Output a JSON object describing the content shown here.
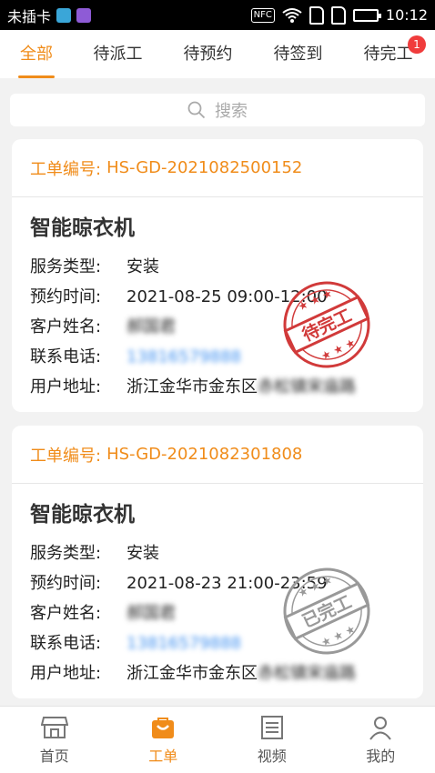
{
  "status_bar": {
    "carrier": "未插卡",
    "nfc": "NFC",
    "time": "10:12"
  },
  "tabs": [
    {
      "label": "全部",
      "active": true
    },
    {
      "label": "待派工"
    },
    {
      "label": "待预约"
    },
    {
      "label": "待签到"
    },
    {
      "label": "待完工",
      "badge": "1"
    }
  ],
  "search": {
    "placeholder": "搜索"
  },
  "orders": [
    {
      "number_label": "工单编号:",
      "number": "HS-GD-2021082500152",
      "product": "智能晾衣机",
      "fields": [
        {
          "label": "服务类型:",
          "value": "安装"
        },
        {
          "label": "预约时间:",
          "value": "2021-08-25 09:00-12:00"
        },
        {
          "label": "客户姓名:",
          "value": "郝国君"
        },
        {
          "label": "联系电话:",
          "value": "13816579888"
        },
        {
          "label": "用户地址:",
          "value": "浙江金华市金东区",
          "blurred": "赤松镇宋庙路"
        }
      ],
      "stamp": "待完工",
      "stamp_color": "#d13a3a"
    },
    {
      "number_label": "工单编号:",
      "number": "HS-GD-2021082301808",
      "product": "智能晾衣机",
      "fields": [
        {
          "label": "服务类型:",
          "value": "安装"
        },
        {
          "label": "预约时间:",
          "value": "2021-08-23 21:00-23:59"
        },
        {
          "label": "客户姓名:",
          "value": "郝国君"
        },
        {
          "label": "联系电话:",
          "value": "13816579888"
        },
        {
          "label": "用户地址:",
          "value": "浙江金华市金东区",
          "blurred": "赤松镇宋庙路"
        }
      ],
      "stamp": "已完工",
      "stamp_color": "#999999"
    }
  ],
  "bottom_nav": [
    {
      "label": "首页",
      "icon": "store-icon"
    },
    {
      "label": "工单",
      "icon": "bag-icon",
      "active": true
    },
    {
      "label": "视频",
      "icon": "document-icon"
    },
    {
      "label": "我的",
      "icon": "person-icon"
    }
  ],
  "colors": {
    "accent": "#f08c1a",
    "badge": "#f03c3c",
    "link": "#3d8ff0"
  }
}
